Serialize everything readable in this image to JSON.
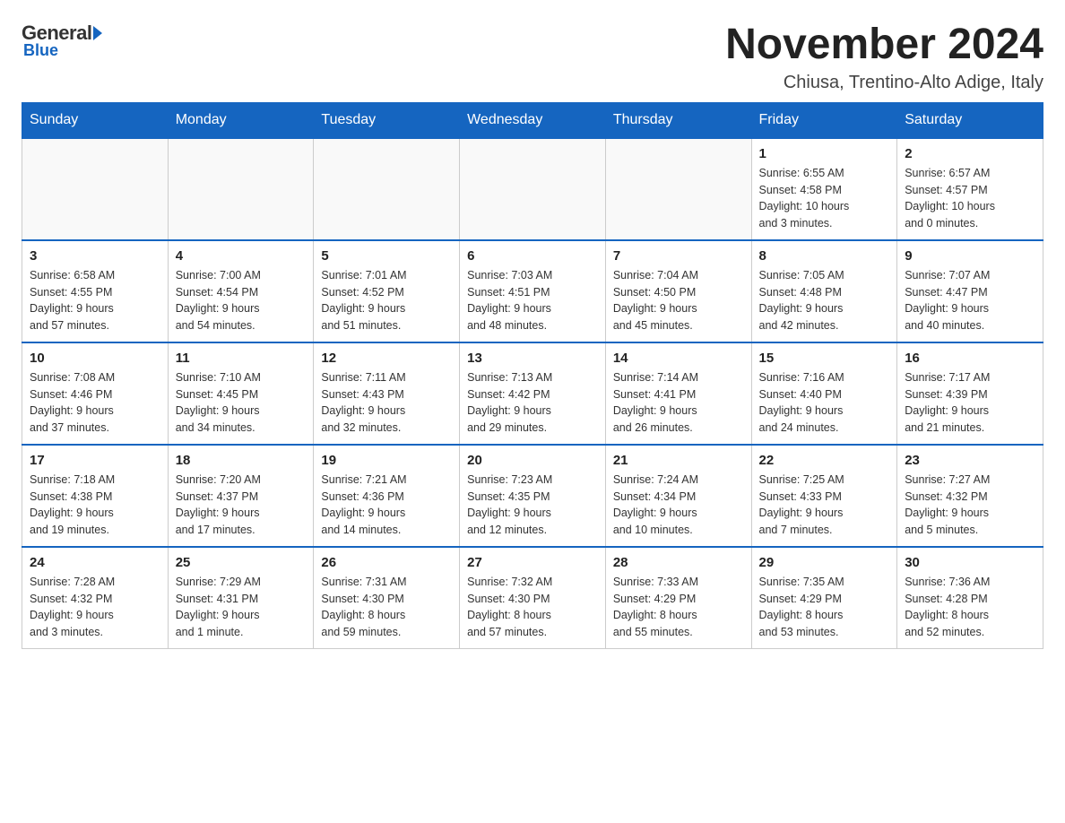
{
  "header": {
    "logo_general": "General",
    "logo_blue": "Blue",
    "month": "November 2024",
    "location": "Chiusa, Trentino-Alto Adige, Italy"
  },
  "days_of_week": [
    "Sunday",
    "Monday",
    "Tuesday",
    "Wednesday",
    "Thursday",
    "Friday",
    "Saturday"
  ],
  "weeks": [
    [
      {
        "day": "",
        "info": ""
      },
      {
        "day": "",
        "info": ""
      },
      {
        "day": "",
        "info": ""
      },
      {
        "day": "",
        "info": ""
      },
      {
        "day": "",
        "info": ""
      },
      {
        "day": "1",
        "info": "Sunrise: 6:55 AM\nSunset: 4:58 PM\nDaylight: 10 hours\nand 3 minutes."
      },
      {
        "day": "2",
        "info": "Sunrise: 6:57 AM\nSunset: 4:57 PM\nDaylight: 10 hours\nand 0 minutes."
      }
    ],
    [
      {
        "day": "3",
        "info": "Sunrise: 6:58 AM\nSunset: 4:55 PM\nDaylight: 9 hours\nand 57 minutes."
      },
      {
        "day": "4",
        "info": "Sunrise: 7:00 AM\nSunset: 4:54 PM\nDaylight: 9 hours\nand 54 minutes."
      },
      {
        "day": "5",
        "info": "Sunrise: 7:01 AM\nSunset: 4:52 PM\nDaylight: 9 hours\nand 51 minutes."
      },
      {
        "day": "6",
        "info": "Sunrise: 7:03 AM\nSunset: 4:51 PM\nDaylight: 9 hours\nand 48 minutes."
      },
      {
        "day": "7",
        "info": "Sunrise: 7:04 AM\nSunset: 4:50 PM\nDaylight: 9 hours\nand 45 minutes."
      },
      {
        "day": "8",
        "info": "Sunrise: 7:05 AM\nSunset: 4:48 PM\nDaylight: 9 hours\nand 42 minutes."
      },
      {
        "day": "9",
        "info": "Sunrise: 7:07 AM\nSunset: 4:47 PM\nDaylight: 9 hours\nand 40 minutes."
      }
    ],
    [
      {
        "day": "10",
        "info": "Sunrise: 7:08 AM\nSunset: 4:46 PM\nDaylight: 9 hours\nand 37 minutes."
      },
      {
        "day": "11",
        "info": "Sunrise: 7:10 AM\nSunset: 4:45 PM\nDaylight: 9 hours\nand 34 minutes."
      },
      {
        "day": "12",
        "info": "Sunrise: 7:11 AM\nSunset: 4:43 PM\nDaylight: 9 hours\nand 32 minutes."
      },
      {
        "day": "13",
        "info": "Sunrise: 7:13 AM\nSunset: 4:42 PM\nDaylight: 9 hours\nand 29 minutes."
      },
      {
        "day": "14",
        "info": "Sunrise: 7:14 AM\nSunset: 4:41 PM\nDaylight: 9 hours\nand 26 minutes."
      },
      {
        "day": "15",
        "info": "Sunrise: 7:16 AM\nSunset: 4:40 PM\nDaylight: 9 hours\nand 24 minutes."
      },
      {
        "day": "16",
        "info": "Sunrise: 7:17 AM\nSunset: 4:39 PM\nDaylight: 9 hours\nand 21 minutes."
      }
    ],
    [
      {
        "day": "17",
        "info": "Sunrise: 7:18 AM\nSunset: 4:38 PM\nDaylight: 9 hours\nand 19 minutes."
      },
      {
        "day": "18",
        "info": "Sunrise: 7:20 AM\nSunset: 4:37 PM\nDaylight: 9 hours\nand 17 minutes."
      },
      {
        "day": "19",
        "info": "Sunrise: 7:21 AM\nSunset: 4:36 PM\nDaylight: 9 hours\nand 14 minutes."
      },
      {
        "day": "20",
        "info": "Sunrise: 7:23 AM\nSunset: 4:35 PM\nDaylight: 9 hours\nand 12 minutes."
      },
      {
        "day": "21",
        "info": "Sunrise: 7:24 AM\nSunset: 4:34 PM\nDaylight: 9 hours\nand 10 minutes."
      },
      {
        "day": "22",
        "info": "Sunrise: 7:25 AM\nSunset: 4:33 PM\nDaylight: 9 hours\nand 7 minutes."
      },
      {
        "day": "23",
        "info": "Sunrise: 7:27 AM\nSunset: 4:32 PM\nDaylight: 9 hours\nand 5 minutes."
      }
    ],
    [
      {
        "day": "24",
        "info": "Sunrise: 7:28 AM\nSunset: 4:32 PM\nDaylight: 9 hours\nand 3 minutes."
      },
      {
        "day": "25",
        "info": "Sunrise: 7:29 AM\nSunset: 4:31 PM\nDaylight: 9 hours\nand 1 minute."
      },
      {
        "day": "26",
        "info": "Sunrise: 7:31 AM\nSunset: 4:30 PM\nDaylight: 8 hours\nand 59 minutes."
      },
      {
        "day": "27",
        "info": "Sunrise: 7:32 AM\nSunset: 4:30 PM\nDaylight: 8 hours\nand 57 minutes."
      },
      {
        "day": "28",
        "info": "Sunrise: 7:33 AM\nSunset: 4:29 PM\nDaylight: 8 hours\nand 55 minutes."
      },
      {
        "day": "29",
        "info": "Sunrise: 7:35 AM\nSunset: 4:29 PM\nDaylight: 8 hours\nand 53 minutes."
      },
      {
        "day": "30",
        "info": "Sunrise: 7:36 AM\nSunset: 4:28 PM\nDaylight: 8 hours\nand 52 minutes."
      }
    ]
  ]
}
